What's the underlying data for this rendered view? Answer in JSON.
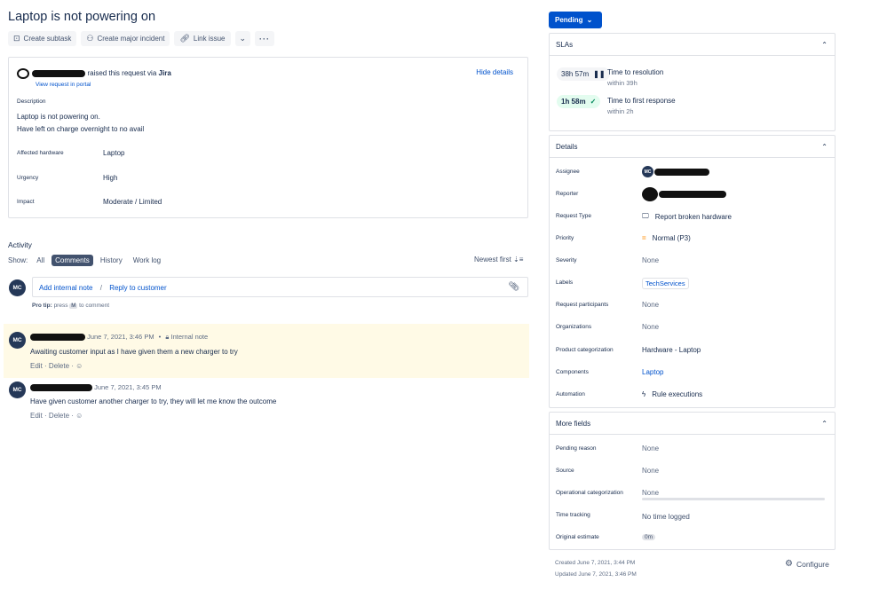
{
  "issue": {
    "title": "Laptop is not powering on"
  },
  "toolbar": {
    "create_subtask": "Create subtask",
    "create_major_incident": "Create major incident",
    "link_issue": "Link issue"
  },
  "request": {
    "raised_text": "raised this request via",
    "raised_via": "Jira",
    "view_in_portal": "View request in portal",
    "hide_details": "Hide details",
    "description_heading": "Description",
    "description_lines": [
      "Laptop is not powering on.",
      "Have left on charge overnight to no avail"
    ],
    "fields": [
      {
        "label": "Affected hardware",
        "value": "Laptop"
      },
      {
        "label": "Urgency",
        "value": "High"
      },
      {
        "label": "Impact",
        "value": "Moderate / Limited"
      }
    ]
  },
  "activity": {
    "heading": "Activity",
    "show_label": "Show:",
    "filters": [
      "All",
      "Comments",
      "History",
      "Work log"
    ],
    "selected_filter": "Comments",
    "sort_label": "Newest first",
    "composer": {
      "avatar": "MC",
      "add_internal_note": "Add internal note",
      "separator": "/",
      "reply_to_customer": "Reply to customer"
    },
    "pro_tip": {
      "bold": "Pro tip:",
      "pre": "press",
      "key": "M",
      "post": "to comment"
    },
    "comments": [
      {
        "avatar": "MC",
        "date": "June 7, 2021, 3:46 PM",
        "badge": "Internal note",
        "body": "Awaiting customer input as I have given them a new charger to try",
        "edit": "Edit",
        "delete": "Delete"
      },
      {
        "avatar": "MC",
        "date": "June 7, 2021, 3:45 PM",
        "body": "Have given customer another charger to try, they will let me know the outcome",
        "edit": "Edit",
        "delete": "Delete"
      }
    ]
  },
  "status": {
    "label": "Pending"
  },
  "slas": {
    "heading": "SLAs",
    "items": [
      {
        "badge": "38h 57m",
        "title": "Time to resolution",
        "sub": "within 39h"
      },
      {
        "badge": "1h 58m",
        "title": "Time to first response",
        "sub": "within 2h"
      }
    ]
  },
  "details": {
    "heading": "Details",
    "assignee_label": "Assignee",
    "assignee_avatar": "MC",
    "reporter_label": "Reporter",
    "request_type": {
      "label": "Request Type",
      "value": "Report broken hardware"
    },
    "priority": {
      "label": "Priority",
      "value": "Normal (P3)"
    },
    "severity": {
      "label": "Severity",
      "value": "None"
    },
    "labels": {
      "label": "Labels",
      "value": "TechServices"
    },
    "request_participants": {
      "label": "Request participants",
      "value": "None"
    },
    "organizations": {
      "label": "Organizations",
      "value": "None"
    },
    "product_categorization": {
      "label": "Product categorization",
      "value": "Hardware - Laptop"
    },
    "components": {
      "label": "Components",
      "value": "Laptop"
    },
    "automation": {
      "label": "Automation",
      "value": "Rule executions"
    }
  },
  "more_fields": {
    "heading": "More fields",
    "pending_reason": {
      "label": "Pending reason",
      "value": "None"
    },
    "source": {
      "label": "Source",
      "value": "None"
    },
    "operational_categorization": {
      "label": "Operational categorization",
      "value": "None"
    },
    "time_tracking": {
      "label": "Time tracking",
      "value": "No time logged"
    },
    "original_estimate": {
      "label": "Original estimate",
      "value": "0m"
    }
  },
  "footer": {
    "created": "Created June 7, 2021, 3:44 PM",
    "updated": "Updated June 7, 2021, 3:46 PM",
    "configure": "Configure"
  },
  "colors": {
    "accent": "#0052cc",
    "internal_note_bg": "#fffae6",
    "avatar_bg": "#253858"
  }
}
